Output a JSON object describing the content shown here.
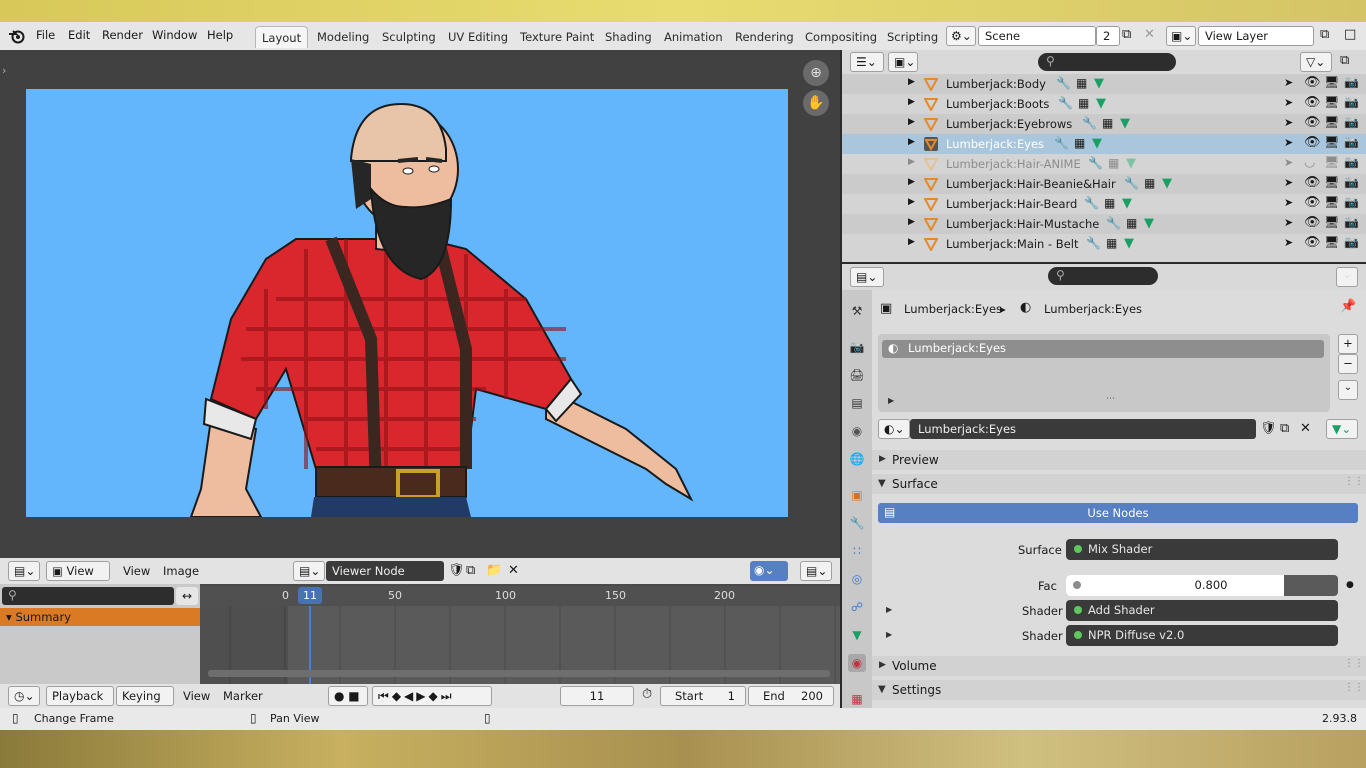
{
  "menu": [
    "File",
    "Edit",
    "Render",
    "Window",
    "Help"
  ],
  "workspaces": [
    "Layout",
    "Modeling",
    "Sculpting",
    "UV Editing",
    "Texture Paint",
    "Shading",
    "Animation",
    "Rendering",
    "Compositing",
    "Scripting"
  ],
  "scene": {
    "name": "Scene",
    "count": "2",
    "view_layer": "View Layer"
  },
  "image_editor": {
    "view_mode": "View",
    "view": "View",
    "image": "Image",
    "viewer_node": "Viewer Node"
  },
  "timeline": {
    "summary": "Summary",
    "ticks": [
      "0",
      "50",
      "100",
      "150",
      "200"
    ],
    "current_frame_badge": "11",
    "playback": "Playback",
    "keying": "Keying",
    "view": "View",
    "marker": "Marker",
    "current_frame": "11",
    "start_label": "Start",
    "start": "1",
    "end_label": "End",
    "end": "200"
  },
  "status": {
    "change_frame": "Change Frame",
    "pan_view": "Pan View",
    "version": "2.93.8"
  },
  "outliner": {
    "rows": [
      {
        "label": "Lumberjack:Body"
      },
      {
        "label": "Lumberjack:Boots"
      },
      {
        "label": "Lumberjack:Eyebrows"
      },
      {
        "label": "Lumberjack:Eyes"
      },
      {
        "label": "Lumberjack:Hair-ANIME"
      },
      {
        "label": "Lumberjack:Hair-Beanie&Hair"
      },
      {
        "label": "Lumberjack:Hair-Beard"
      },
      {
        "label": "Lumberjack:Hair-Mustache"
      },
      {
        "label": "Lumberjack:Main - Belt"
      }
    ]
  },
  "properties": {
    "breadcrumb_object": "Lumberjack:Eyes",
    "breadcrumb_material": "Lumberjack:Eyes",
    "slot": "Lumberjack:Eyes",
    "material_name": "Lumberjack:Eyes",
    "preview": "Preview",
    "surface_panel": "Surface",
    "use_nodes": "Use Nodes",
    "surface_label": "Surface",
    "surface_value": "Mix Shader",
    "fac_label": "Fac",
    "fac_value": "0.800",
    "fac_fraction": 0.8,
    "shader1_label": "Shader",
    "shader1_value": "Add Shader",
    "shader2_label": "Shader",
    "shader2_value": "NPR Diffuse v2.0",
    "volume": "Volume",
    "settings": "Settings"
  },
  "colors": {
    "accent": "#5680c2",
    "selected_row": "#a9c6dc",
    "summary": "#db7a24",
    "viewport_bg": "#63b6fb",
    "socket_green": "#5ec75e"
  }
}
